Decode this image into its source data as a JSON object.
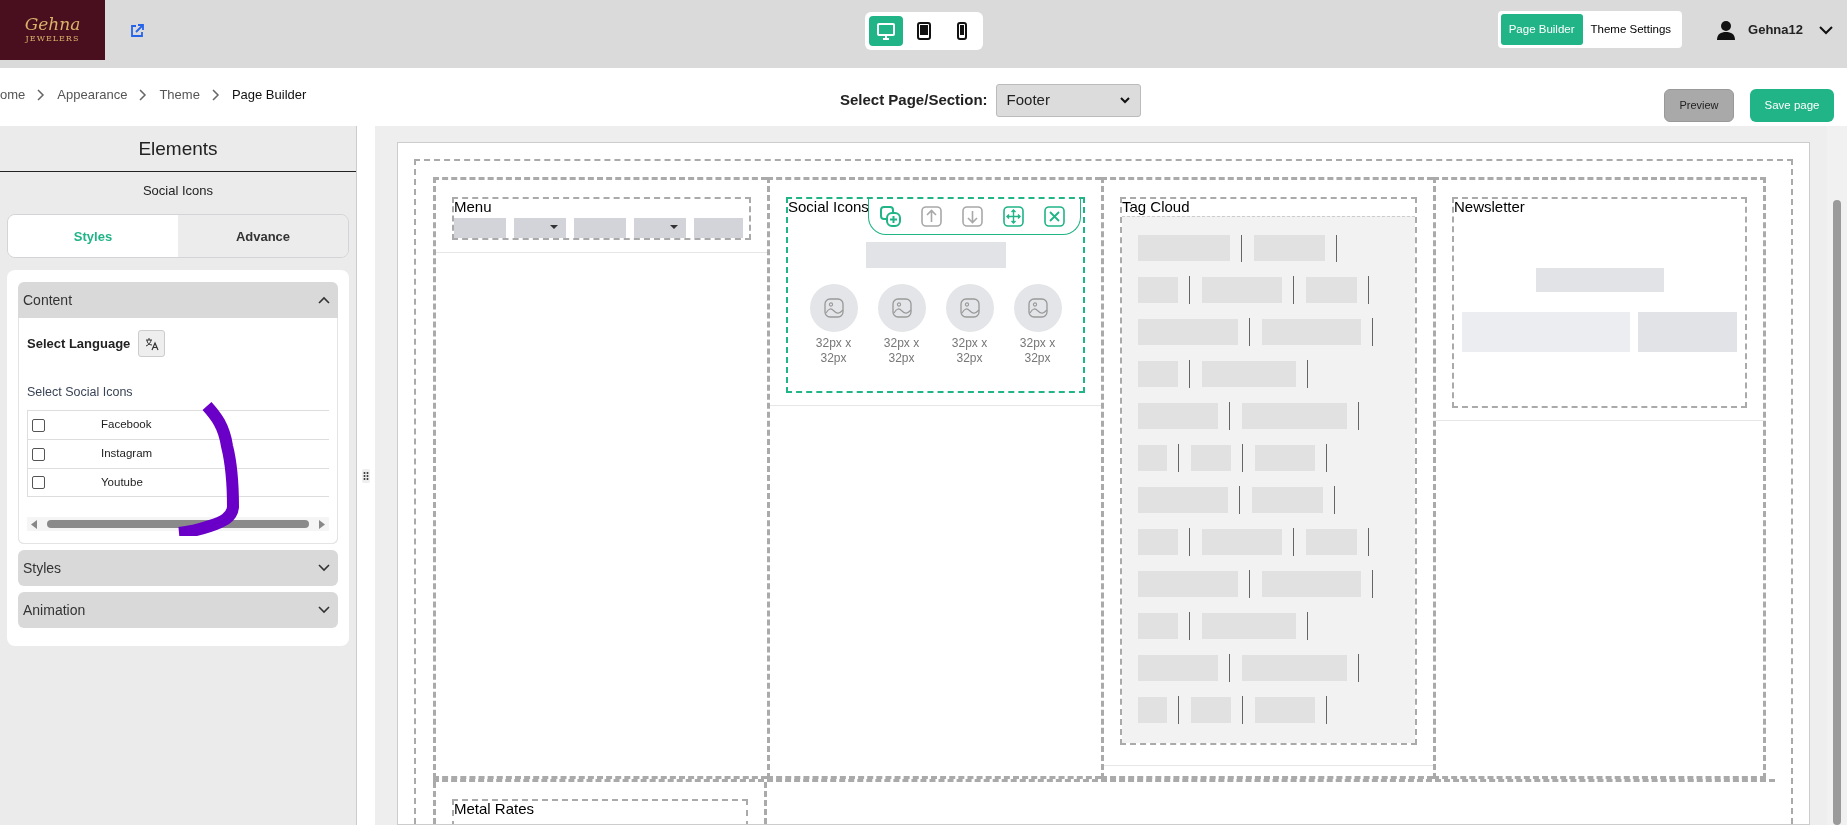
{
  "header": {
    "logo": {
      "title": "Gehna",
      "subtitle": "JEWELERS"
    },
    "devices": [
      {
        "kind": "desktop",
        "selected": true
      },
      {
        "kind": "tablet",
        "selected": false
      },
      {
        "kind": "mobile",
        "selected": false
      }
    ],
    "modes": [
      {
        "label": "Page Builder",
        "selected": true
      },
      {
        "label": "Theme Settings",
        "selected": false
      }
    ],
    "user": {
      "name": "Gehna12"
    }
  },
  "breadcrumb": [
    "ome",
    "Appearance",
    "Theme",
    "Page Builder"
  ],
  "page_select": {
    "label": "Select Page/Section:",
    "value": "Footer"
  },
  "actions": {
    "preview": "Preview",
    "save": "Save page"
  },
  "sidebar": {
    "title": "Elements",
    "subtitle": "Social Icons",
    "tabs": [
      {
        "label": "Styles",
        "selected": true
      },
      {
        "label": "Advance",
        "selected": false
      }
    ],
    "sections": [
      {
        "title": "Content",
        "expanded": true
      },
      {
        "title": "Styles",
        "expanded": false
      },
      {
        "title": "Animation",
        "expanded": false
      }
    ],
    "language_label": "Select Language",
    "social_label": "Select Social Icons",
    "social_options": [
      {
        "label": "Facebook",
        "checked": false
      },
      {
        "label": "Instagram",
        "checked": false
      },
      {
        "label": "Youtube",
        "checked": false
      }
    ]
  },
  "canvas": {
    "columns": [
      {
        "kind": "menu",
        "title": "Menu",
        "selected": false
      },
      {
        "kind": "social",
        "title": "Social Icons",
        "selected": true,
        "icon_captions": [
          "32px x 32px",
          "32px x 32px",
          "32px x 32px",
          "32px x 32px"
        ]
      },
      {
        "kind": "tagcloud",
        "title": "Tag Cloud",
        "selected": false
      },
      {
        "kind": "newsletter",
        "title": "Newsletter",
        "selected": false
      }
    ],
    "toolbar": [
      {
        "kind": "duplicate",
        "disabled": false
      },
      {
        "kind": "up",
        "disabled": true
      },
      {
        "kind": "down",
        "disabled": true
      },
      {
        "kind": "move",
        "disabled": false
      },
      {
        "kind": "close",
        "disabled": false
      }
    ],
    "bottom": [
      {
        "kind": "metal",
        "title": "Metal Rates"
      }
    ]
  }
}
